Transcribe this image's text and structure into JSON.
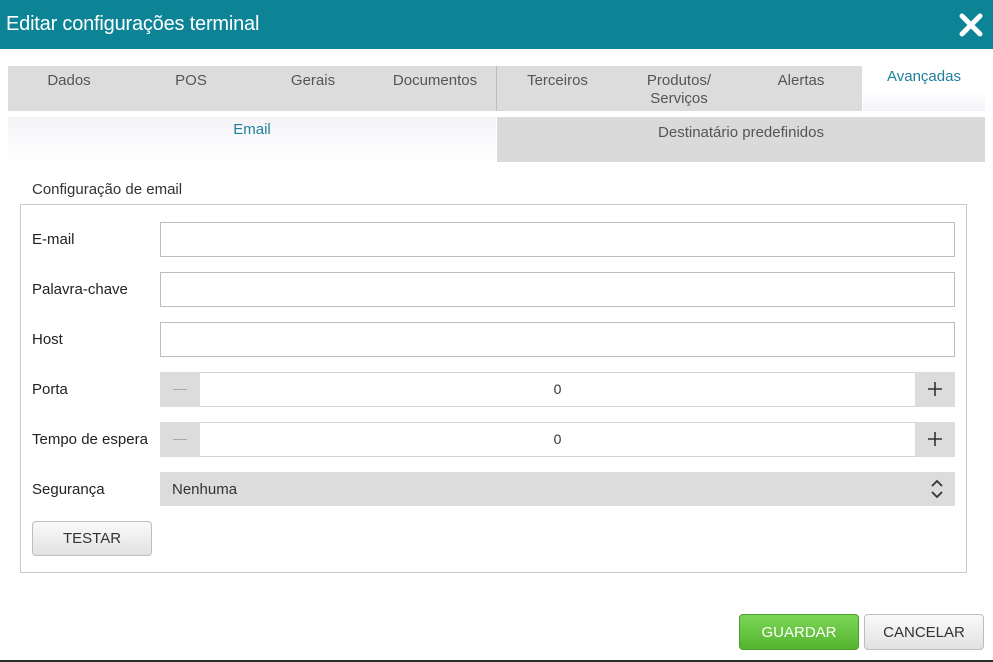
{
  "window": {
    "title": "Editar configurações terminal",
    "close_icon": "close-icon",
    "titlebar_color": "#0d8495"
  },
  "main_tabs": [
    {
      "label": "Dados",
      "active": false
    },
    {
      "label": "POS",
      "active": false
    },
    {
      "label": "Gerais",
      "active": false
    },
    {
      "label": "Documentos",
      "active": false
    },
    {
      "label": "Terceiros",
      "active": false
    },
    {
      "label": "Produtos/ Serviços",
      "active": false
    },
    {
      "label": "Alertas",
      "active": false
    },
    {
      "label": "Avançadas",
      "active": true
    }
  ],
  "sub_tabs": [
    {
      "label": "Email",
      "active": true
    },
    {
      "label": "Destinatário predefinidos",
      "active": false
    }
  ],
  "form": {
    "section_title": "Configuração de email",
    "email": {
      "label": "E-mail",
      "value": ""
    },
    "password": {
      "label": "Palavra-chave",
      "value": ""
    },
    "host": {
      "label": "Host",
      "value": ""
    },
    "port": {
      "label": "Porta",
      "value": "0"
    },
    "timeout": {
      "label": "Tempo de espera",
      "value": "0"
    },
    "security": {
      "label": "Segurança",
      "selected": "Nenhuma"
    },
    "test_button": "TESTAR"
  },
  "footer": {
    "save_label": "GUARDAR",
    "cancel_label": "CANCELAR",
    "save_color": "#5cb836"
  }
}
